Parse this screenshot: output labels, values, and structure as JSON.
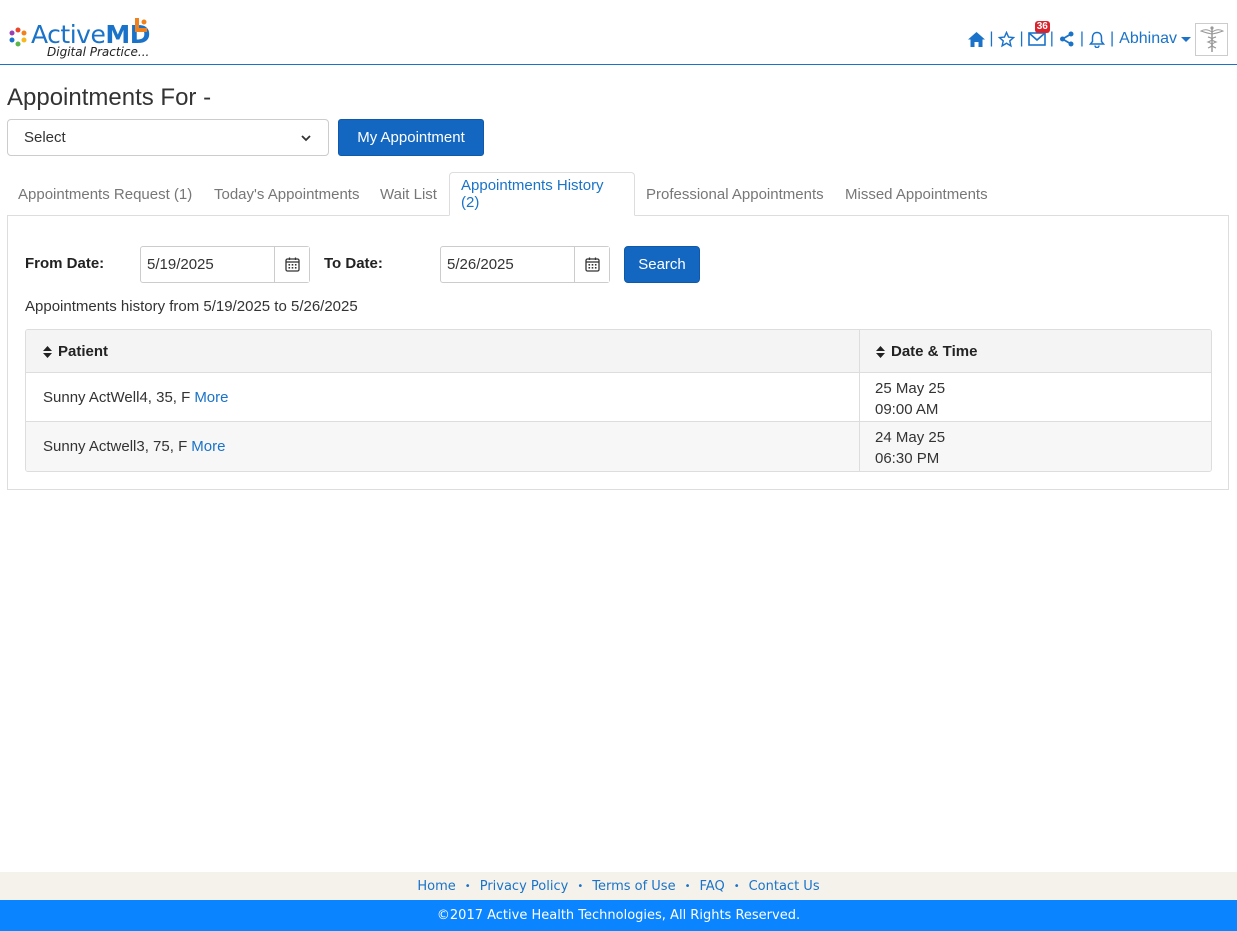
{
  "brand": {
    "name_part1": "Active",
    "name_part2": "MD",
    "tagline": "Digital Practice...",
    "accent": "#1a73c8",
    "orange": "#f0821e"
  },
  "header": {
    "icons": [
      "home-icon",
      "star-icon",
      "mail-icon",
      "share-icon",
      "bell-icon"
    ],
    "mail_badge": "36",
    "user_name": "Abhinav",
    "separator": "|"
  },
  "page": {
    "title": "Appointments For -",
    "select": {
      "value": "Select"
    },
    "my_appointment_label": "My Appointment"
  },
  "tabs": [
    {
      "label": "Appointments Request (1)",
      "active": false
    },
    {
      "label": "Today's Appointments",
      "active": false
    },
    {
      "label": "Wait List",
      "active": false
    },
    {
      "label": "Appointments History (2)",
      "active": true
    },
    {
      "label": "Professional Appointments",
      "active": false
    },
    {
      "label": "Missed Appointments",
      "active": false
    }
  ],
  "filter": {
    "from_label": "From Date:",
    "from_value": "5/19/2025",
    "to_label": "To Date:",
    "to_value": "5/26/2025",
    "search_label": "Search"
  },
  "history_text": "Appointments history from 5/19/2025 to 5/26/2025",
  "table": {
    "headers": [
      "Patient",
      "Date & Time"
    ],
    "rows": [
      {
        "patient": "Sunny ActWell4, 35, F",
        "more": "More",
        "date": "25 May 25",
        "time": "09:00 AM"
      },
      {
        "patient": "Sunny Actwell3, 75, F",
        "more": "More",
        "date": "24 May 25",
        "time": "06:30 PM"
      }
    ]
  },
  "footer": {
    "links": [
      "Home",
      "Privacy Policy",
      "Terms of Use",
      "FAQ",
      "Contact Us"
    ],
    "bullet": "•",
    "copyright": "©2017 Active Health Technologies, All Rights Reserved.",
    "bar_color": "#0a84ff"
  }
}
